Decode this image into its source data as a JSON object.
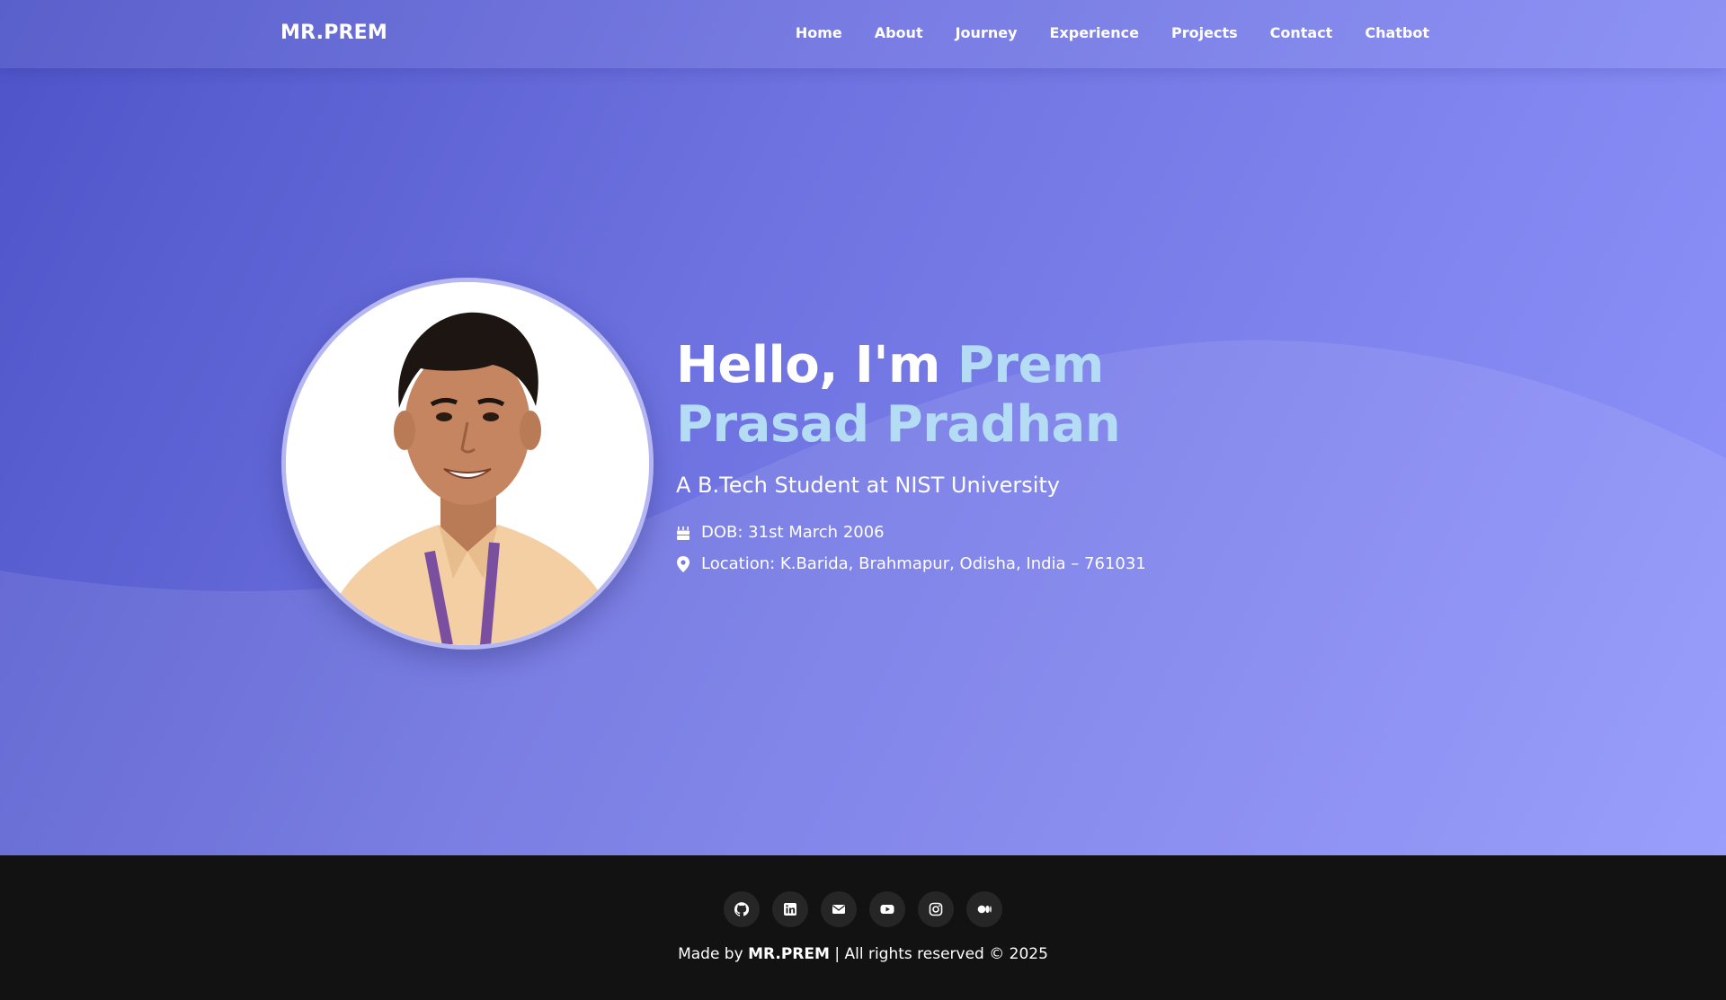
{
  "navbar": {
    "brand": "MR.PREM",
    "links": [
      "Home",
      "About",
      "Journey",
      "Experience",
      "Projects",
      "Contact",
      "Chatbot"
    ]
  },
  "hero": {
    "greeting": "Hello, I'm ",
    "name": "Prem Prasad Pradhan",
    "subtitle": "A B.Tech Student at NIST University",
    "dob": "DOB: 31st March 2006",
    "location": "Location: K.Barida, Brahmapur, Odisha, India – 761031",
    "photo": "profile-photo"
  },
  "footer": {
    "social_icons": [
      "github-icon",
      "linkedin-icon",
      "envelope-icon",
      "youtube-icon",
      "instagram-icon",
      "medium-icon"
    ],
    "made_by_prefix": "Made by ",
    "made_by_name": "MR.PREM",
    "rights": " | All rights reserved © 2025"
  },
  "colors": {
    "gradient_start": "#4e54c8",
    "gradient_end": "#8f94fb",
    "name_accent": "#b4dcf5",
    "footer_bg": "#121212"
  }
}
